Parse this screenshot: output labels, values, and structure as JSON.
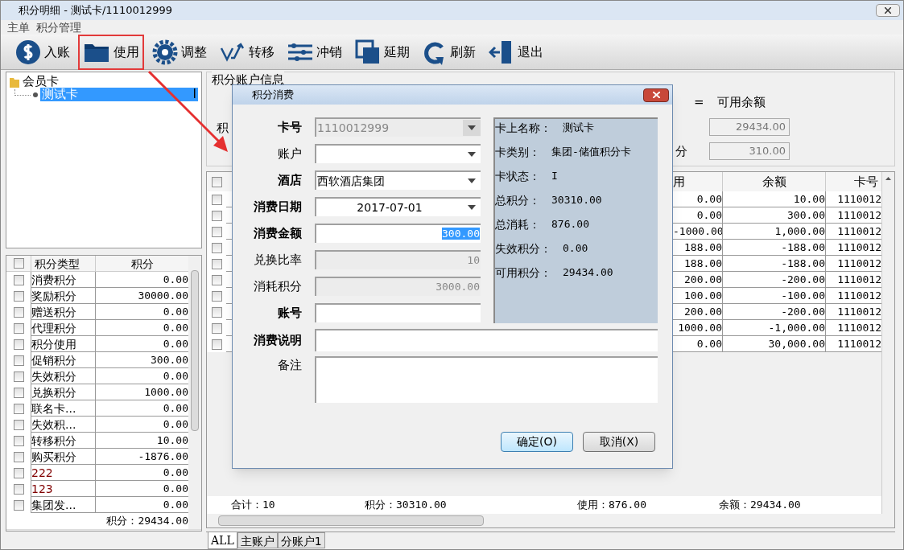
{
  "window": {
    "title": "积分明细 - 测试卡/1110012999"
  },
  "menu": [
    "主单",
    "积分管理"
  ],
  "toolbar": [
    {
      "label": "入账",
      "kind": "dollar",
      "highlighted": false
    },
    {
      "label": "使用",
      "kind": "folder",
      "highlighted": true
    },
    {
      "label": "调整",
      "kind": "gear",
      "highlighted": false
    },
    {
      "label": "转移",
      "kind": "transfer",
      "highlighted": false
    },
    {
      "label": "冲销",
      "kind": "sliders",
      "highlighted": false
    },
    {
      "label": "延期",
      "kind": "squares",
      "highlighted": false
    },
    {
      "label": "刷新",
      "kind": "refresh",
      "highlighted": false
    },
    {
      "label": "退出",
      "kind": "exit",
      "highlighted": false
    }
  ],
  "tree": {
    "label": "会员卡",
    "children": [
      {
        "label": "测试卡",
        "status": "I",
        "selected": true
      }
    ]
  },
  "points_grid": {
    "all_checked": false,
    "columns": [
      "积分类型",
      "积分"
    ],
    "rows": [
      {
        "type": "消费积分",
        "points": "0.00",
        "checked": false
      },
      {
        "type": "奖励积分",
        "points": "30000.00",
        "checked": false
      },
      {
        "type": "赠送积分",
        "points": "0.00",
        "checked": false
      },
      {
        "type": "代理积分",
        "points": "0.00",
        "checked": false
      },
      {
        "type": "积分使用",
        "points": "0.00",
        "checked": false
      },
      {
        "type": "促销积分",
        "points": "300.00",
        "checked": false
      },
      {
        "type": "失效积分",
        "points": "0.00",
        "checked": false
      },
      {
        "type": "兑换积分",
        "points": "1000.00",
        "checked": false
      },
      {
        "type": "联名卡...",
        "points": "0.00",
        "checked": false
      },
      {
        "type": "失效积...",
        "points": "0.00",
        "checked": false
      },
      {
        "type": "转移积分",
        "points": "10.00",
        "checked": false
      },
      {
        "type": "购买积分",
        "points": "-1876.00",
        "checked": false
      },
      {
        "type": "222",
        "points": "0.00",
        "color": "#800000",
        "checked": false
      },
      {
        "type": "123",
        "points": "0.00",
        "color": "#800000",
        "checked": false
      },
      {
        "type": "集团发...",
        "points": "0.00",
        "checked": false
      }
    ],
    "footer": "积分：29434.00"
  },
  "account_info": {
    "title": "积分账户信息",
    "fragment_1": "积",
    "fragment_2": "分",
    "equals": "=",
    "available_label": "可用余额",
    "available": "29434.00",
    "frozen": "310.00"
  },
  "detail_table": {
    "all_checked": false,
    "columns": [
      "用",
      "余额",
      "卡号"
    ],
    "rows": [
      {
        "checked": false,
        "cells": [
          "0.00",
          "10.00",
          "1110012"
        ]
      },
      {
        "checked": false,
        "cells": [
          "0.00",
          "300.00",
          "1110012"
        ]
      },
      {
        "checked": false,
        "cells": [
          "-1000.00",
          "1,000.00",
          "1110012"
        ]
      },
      {
        "checked": false,
        "cells": [
          "188.00",
          "-188.00",
          "1110012"
        ]
      },
      {
        "checked": false,
        "cells": [
          "188.00",
          "-188.00",
          "1110012"
        ]
      },
      {
        "checked": false,
        "cells": [
          "200.00",
          "-200.00",
          "1110012"
        ]
      },
      {
        "checked": false,
        "cells": [
          "100.00",
          "-100.00",
          "1110012"
        ]
      },
      {
        "checked": false,
        "cells": [
          "200.00",
          "-200.00",
          "1110012"
        ]
      },
      {
        "checked": false,
        "cells": [
          "1000.00",
          "-1,000.00",
          "1110012"
        ]
      },
      {
        "checked": false,
        "cells": [
          "0.00",
          "30,000.00",
          "1110012"
        ]
      }
    ],
    "totals": [
      "合计：10",
      "积分：30310.00",
      "使用：876.00",
      "余额：29434.00"
    ]
  },
  "tabs": [
    {
      "label": "ALL",
      "selected": true
    },
    {
      "label": "主账户",
      "selected": false
    },
    {
      "label": "分账户1",
      "selected": false
    }
  ],
  "dialog": {
    "title": "积分消费",
    "fields": [
      {
        "label": "卡号",
        "bold": true,
        "kind": "combo",
        "value": "1110012999",
        "disabled": true
      },
      {
        "label": "账户",
        "bold": false,
        "kind": "combo",
        "disabled": false
      },
      {
        "label": "酒店",
        "bold": true,
        "kind": "combo",
        "value": "西软酒店集团",
        "disabled": false
      },
      {
        "label": "消费日期",
        "bold": true,
        "kind": "date",
        "value": "2017-07-01",
        "disabled": false
      },
      {
        "label": "消费金额",
        "bold": true,
        "kind": "number",
        "value": "300.00",
        "disabled": false
      },
      {
        "label": "兑换比率",
        "bold": false,
        "kind": "number",
        "value": "10",
        "disabled": true
      },
      {
        "label": "消耗积分",
        "bold": false,
        "kind": "number",
        "value": "3000.00",
        "disabled": true
      },
      {
        "label": "账号",
        "bold": true,
        "kind": "text",
        "disabled": false
      }
    ],
    "description_label": "消费说明",
    "remark_label": "备注",
    "info": [
      {
        "label": "卡上名称：",
        "value": "测试卡"
      },
      {
        "label": "卡类别：",
        "value": "集团-储值积分卡"
      },
      {
        "label": "卡状态：",
        "value": "I"
      },
      {
        "label": "总积分：",
        "value": "30310.00"
      },
      {
        "label": "总消耗：",
        "value": "876.00"
      },
      {
        "label": "失效积分：",
        "value": "0.00"
      },
      {
        "label": "可用积分：",
        "value": "29434.00"
      }
    ],
    "buttons": [
      "确定(O)",
      "取消(X)"
    ]
  }
}
